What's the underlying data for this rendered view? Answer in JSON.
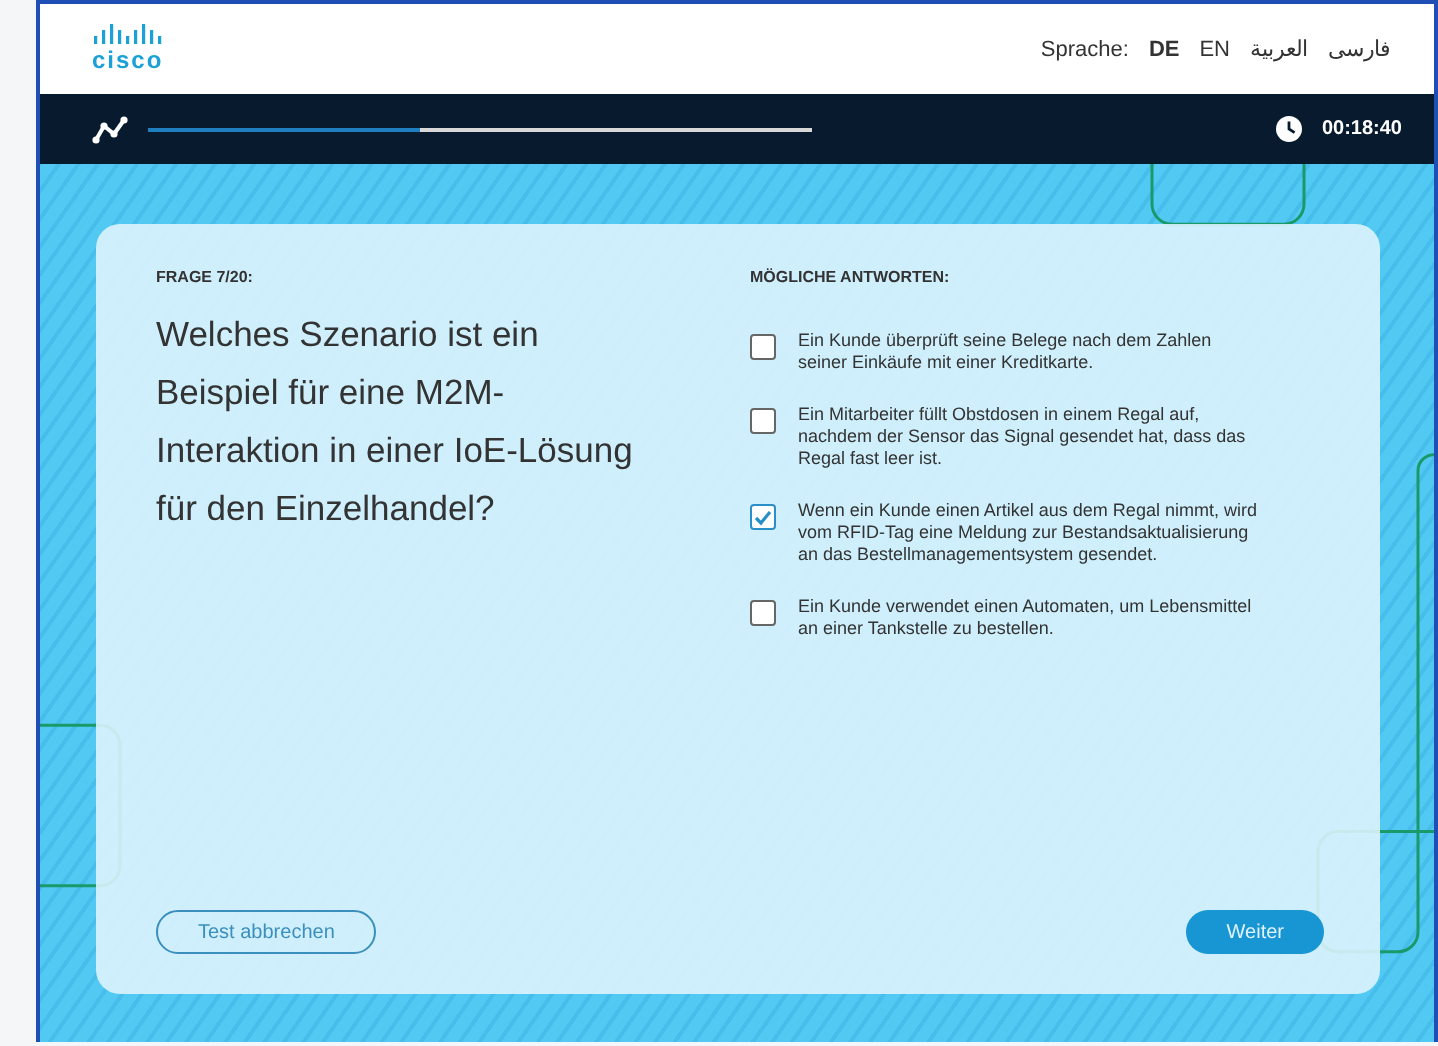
{
  "header": {
    "logo": "cisco",
    "language_label": "Sprache:",
    "languages": [
      {
        "label": "DE",
        "selected": true
      },
      {
        "label": "EN",
        "selected": false
      },
      {
        "label": "العربية",
        "selected": false
      },
      {
        "label": "فارسی",
        "selected": false
      }
    ]
  },
  "progress": {
    "level": 0.41,
    "timer": "00:18:40"
  },
  "question": {
    "number": "FRAGE 7/20:",
    "text": "Welches Szenario ist ein Beispiel für eine M2M-Interaktion in einer IoE-Lösung für den Einzelhandel?"
  },
  "answers_heading": "MÖGLICHE ANTWORTEN:",
  "answers": [
    {
      "text": "Ein Kunde überprüft seine Belege nach dem Zahlen seiner Einkäufe mit einer Kreditkarte.",
      "checked": false
    },
    {
      "text": "Ein Mitarbeiter füllt Obstdosen in einem Regal auf, nachdem der Sensor das Signal gesendet hat, dass das Regal fast leer ist.",
      "checked": false
    },
    {
      "text": "Wenn ein Kunde einen Artikel aus dem Regal nimmt, wird vom RFID-Tag eine Meldung zur Bestandsaktualisierung an das Bestellmanagementsystem gesendet.",
      "checked": true
    },
    {
      "text": "Ein Kunde verwendet einen Automaten, um Lebensmittel an einer Tankstelle zu bestellen.",
      "checked": false
    }
  ],
  "buttons": {
    "cancel": "Test abbrechen",
    "next": "Weiter"
  }
}
